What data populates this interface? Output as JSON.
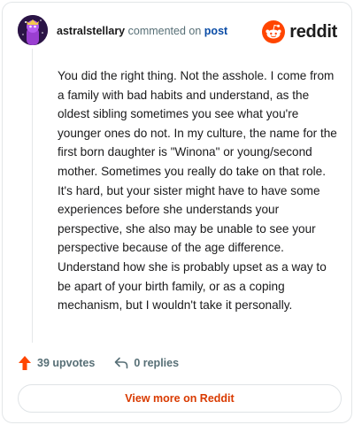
{
  "header": {
    "username": "astralstellary",
    "action_text": "commented on",
    "post_link": "post",
    "brand": "reddit"
  },
  "comment": {
    "body": "You did the right thing. Not the asshole. I come from a family with bad habits and understand, as the oldest sibling sometimes you see what you're younger ones do not. In my culture, the name for the first born daughter is \"Winona\" or young/second mother. Sometimes you really do take on that role. It's hard, but your sister might have to have some experiences before she understands your perspective, she also may be unable to see your perspective because of the age difference. Understand how she is probably upset as a way to be apart of your birth family, or as a coping mechanism, but I wouldn't take it personally."
  },
  "footer": {
    "upvotes": "39 upvotes",
    "replies": "0 replies",
    "view_more": "View more on Reddit"
  },
  "colors": {
    "brand_orange": "#ff4500",
    "link_blue": "#0a4ca6",
    "view_more_text": "#d93a00",
    "muted": "#576f76"
  },
  "icons": [
    "user-avatar",
    "reddit-logo-icon",
    "upvote-arrow-icon",
    "reply-arrow-icon"
  ]
}
